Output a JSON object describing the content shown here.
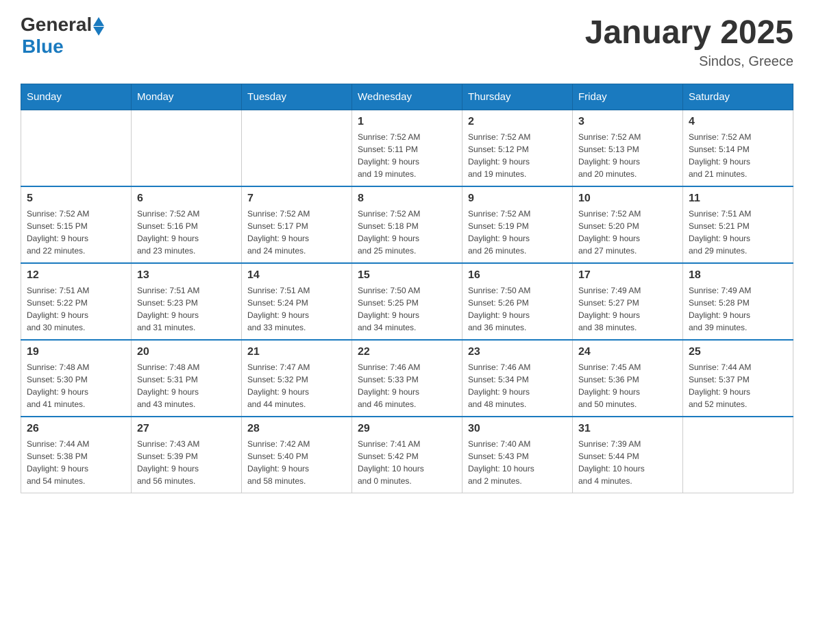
{
  "logo": {
    "general": "General",
    "blue": "Blue"
  },
  "title": "January 2025",
  "location": "Sindos, Greece",
  "days_header": [
    "Sunday",
    "Monday",
    "Tuesday",
    "Wednesday",
    "Thursday",
    "Friday",
    "Saturday"
  ],
  "weeks": [
    [
      {
        "day": "",
        "info": ""
      },
      {
        "day": "",
        "info": ""
      },
      {
        "day": "",
        "info": ""
      },
      {
        "day": "1",
        "info": "Sunrise: 7:52 AM\nSunset: 5:11 PM\nDaylight: 9 hours\nand 19 minutes."
      },
      {
        "day": "2",
        "info": "Sunrise: 7:52 AM\nSunset: 5:12 PM\nDaylight: 9 hours\nand 19 minutes."
      },
      {
        "day": "3",
        "info": "Sunrise: 7:52 AM\nSunset: 5:13 PM\nDaylight: 9 hours\nand 20 minutes."
      },
      {
        "day": "4",
        "info": "Sunrise: 7:52 AM\nSunset: 5:14 PM\nDaylight: 9 hours\nand 21 minutes."
      }
    ],
    [
      {
        "day": "5",
        "info": "Sunrise: 7:52 AM\nSunset: 5:15 PM\nDaylight: 9 hours\nand 22 minutes."
      },
      {
        "day": "6",
        "info": "Sunrise: 7:52 AM\nSunset: 5:16 PM\nDaylight: 9 hours\nand 23 minutes."
      },
      {
        "day": "7",
        "info": "Sunrise: 7:52 AM\nSunset: 5:17 PM\nDaylight: 9 hours\nand 24 minutes."
      },
      {
        "day": "8",
        "info": "Sunrise: 7:52 AM\nSunset: 5:18 PM\nDaylight: 9 hours\nand 25 minutes."
      },
      {
        "day": "9",
        "info": "Sunrise: 7:52 AM\nSunset: 5:19 PM\nDaylight: 9 hours\nand 26 minutes."
      },
      {
        "day": "10",
        "info": "Sunrise: 7:52 AM\nSunset: 5:20 PM\nDaylight: 9 hours\nand 27 minutes."
      },
      {
        "day": "11",
        "info": "Sunrise: 7:51 AM\nSunset: 5:21 PM\nDaylight: 9 hours\nand 29 minutes."
      }
    ],
    [
      {
        "day": "12",
        "info": "Sunrise: 7:51 AM\nSunset: 5:22 PM\nDaylight: 9 hours\nand 30 minutes."
      },
      {
        "day": "13",
        "info": "Sunrise: 7:51 AM\nSunset: 5:23 PM\nDaylight: 9 hours\nand 31 minutes."
      },
      {
        "day": "14",
        "info": "Sunrise: 7:51 AM\nSunset: 5:24 PM\nDaylight: 9 hours\nand 33 minutes."
      },
      {
        "day": "15",
        "info": "Sunrise: 7:50 AM\nSunset: 5:25 PM\nDaylight: 9 hours\nand 34 minutes."
      },
      {
        "day": "16",
        "info": "Sunrise: 7:50 AM\nSunset: 5:26 PM\nDaylight: 9 hours\nand 36 minutes."
      },
      {
        "day": "17",
        "info": "Sunrise: 7:49 AM\nSunset: 5:27 PM\nDaylight: 9 hours\nand 38 minutes."
      },
      {
        "day": "18",
        "info": "Sunrise: 7:49 AM\nSunset: 5:28 PM\nDaylight: 9 hours\nand 39 minutes."
      }
    ],
    [
      {
        "day": "19",
        "info": "Sunrise: 7:48 AM\nSunset: 5:30 PM\nDaylight: 9 hours\nand 41 minutes."
      },
      {
        "day": "20",
        "info": "Sunrise: 7:48 AM\nSunset: 5:31 PM\nDaylight: 9 hours\nand 43 minutes."
      },
      {
        "day": "21",
        "info": "Sunrise: 7:47 AM\nSunset: 5:32 PM\nDaylight: 9 hours\nand 44 minutes."
      },
      {
        "day": "22",
        "info": "Sunrise: 7:46 AM\nSunset: 5:33 PM\nDaylight: 9 hours\nand 46 minutes."
      },
      {
        "day": "23",
        "info": "Sunrise: 7:46 AM\nSunset: 5:34 PM\nDaylight: 9 hours\nand 48 minutes."
      },
      {
        "day": "24",
        "info": "Sunrise: 7:45 AM\nSunset: 5:36 PM\nDaylight: 9 hours\nand 50 minutes."
      },
      {
        "day": "25",
        "info": "Sunrise: 7:44 AM\nSunset: 5:37 PM\nDaylight: 9 hours\nand 52 minutes."
      }
    ],
    [
      {
        "day": "26",
        "info": "Sunrise: 7:44 AM\nSunset: 5:38 PM\nDaylight: 9 hours\nand 54 minutes."
      },
      {
        "day": "27",
        "info": "Sunrise: 7:43 AM\nSunset: 5:39 PM\nDaylight: 9 hours\nand 56 minutes."
      },
      {
        "day": "28",
        "info": "Sunrise: 7:42 AM\nSunset: 5:40 PM\nDaylight: 9 hours\nand 58 minutes."
      },
      {
        "day": "29",
        "info": "Sunrise: 7:41 AM\nSunset: 5:42 PM\nDaylight: 10 hours\nand 0 minutes."
      },
      {
        "day": "30",
        "info": "Sunrise: 7:40 AM\nSunset: 5:43 PM\nDaylight: 10 hours\nand 2 minutes."
      },
      {
        "day": "31",
        "info": "Sunrise: 7:39 AM\nSunset: 5:44 PM\nDaylight: 10 hours\nand 4 minutes."
      },
      {
        "day": "",
        "info": ""
      }
    ]
  ]
}
